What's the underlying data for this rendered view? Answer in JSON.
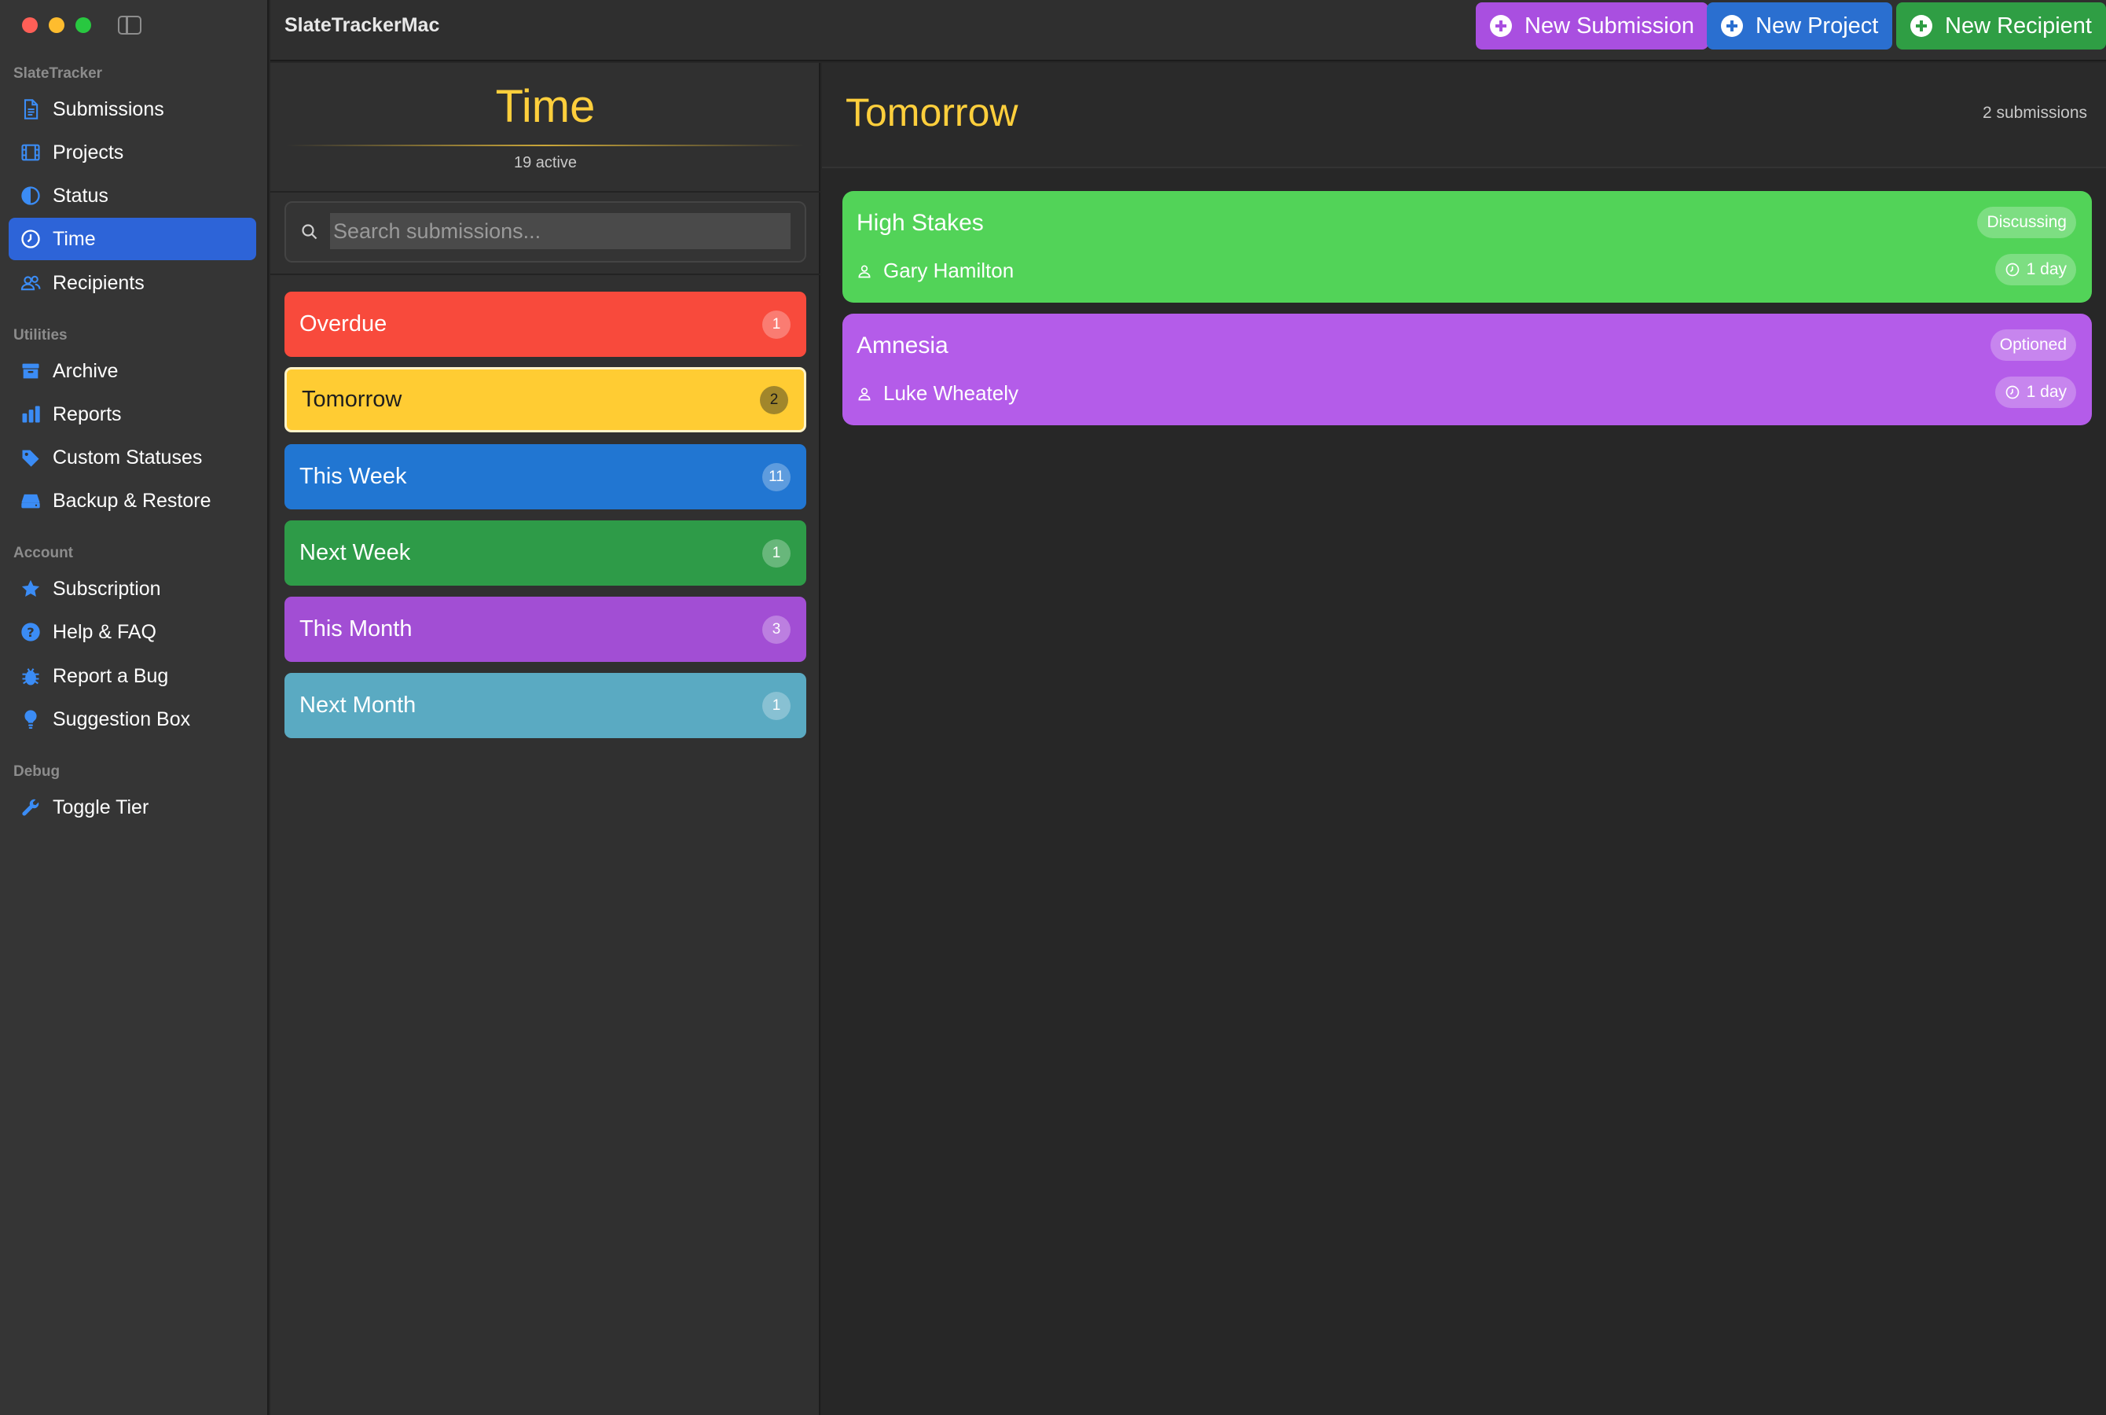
{
  "app": {
    "title": "SlateTrackerMac"
  },
  "toolbar": {
    "buttons": [
      {
        "label": "New Submission",
        "color": "#a94fe0",
        "icon": "plus-circle-icon"
      },
      {
        "label": "New Project",
        "color": "#2a6fd0",
        "icon": "plus-circle-icon"
      },
      {
        "label": "New Recipient",
        "color": "#2f9e44",
        "icon": "plus-circle-icon"
      }
    ]
  },
  "sidebar": {
    "sections": [
      {
        "label": "SlateTracker",
        "items": [
          {
            "label": "Submissions",
            "icon": "document-icon"
          },
          {
            "label": "Projects",
            "icon": "film-icon"
          },
          {
            "label": "Status",
            "icon": "half-circle-icon"
          },
          {
            "label": "Time",
            "icon": "clock-icon",
            "selected": true
          },
          {
            "label": "Recipients",
            "icon": "people-icon"
          }
        ]
      },
      {
        "label": "Utilities",
        "items": [
          {
            "label": "Archive",
            "icon": "archive-box-icon"
          },
          {
            "label": "Reports",
            "icon": "bar-chart-icon"
          },
          {
            "label": "Custom Statuses",
            "icon": "tag-icon"
          },
          {
            "label": "Backup & Restore",
            "icon": "drive-icon"
          }
        ]
      },
      {
        "label": "Account",
        "items": [
          {
            "label": "Subscription",
            "icon": "star-icon"
          },
          {
            "label": "Help & FAQ",
            "icon": "question-circle-icon"
          },
          {
            "label": "Report a Bug",
            "icon": "bug-icon"
          },
          {
            "label": "Suggestion Box",
            "icon": "lightbulb-icon"
          }
        ]
      },
      {
        "label": "Debug",
        "items": [
          {
            "label": "Toggle Tier",
            "icon": "wrench-icon"
          }
        ]
      }
    ],
    "accent": "#2d64d8",
    "icon_color": "#3b8cf5"
  },
  "middle": {
    "title": "Time",
    "subtitle": "19 active",
    "search": {
      "placeholder": "Search submissions...",
      "value": ""
    },
    "buckets": [
      {
        "label": "Overdue",
        "count": "1",
        "color": "#f84a3c"
      },
      {
        "label": "Tomorrow",
        "count": "2",
        "color": "#ffcc33",
        "selected": true
      },
      {
        "label": "This Week",
        "count": "11",
        "color": "#2176d2"
      },
      {
        "label": "Next Week",
        "count": "1",
        "color": "#2e9b48"
      },
      {
        "label": "This Month",
        "count": "3",
        "color": "#a24ed4"
      },
      {
        "label": "Next Month",
        "count": "1",
        "color": "#5aaac2"
      }
    ]
  },
  "detail": {
    "title": "Tomorrow",
    "count_label": "2 submissions",
    "cards": [
      {
        "title": "High Stakes",
        "person": "Gary Hamilton",
        "status": "Discussing",
        "due": "1 day",
        "color": "#52d358"
      },
      {
        "title": "Amnesia",
        "person": "Luke Wheately",
        "status": "Optioned",
        "due": "1 day",
        "color": "#b45ce9"
      }
    ]
  }
}
